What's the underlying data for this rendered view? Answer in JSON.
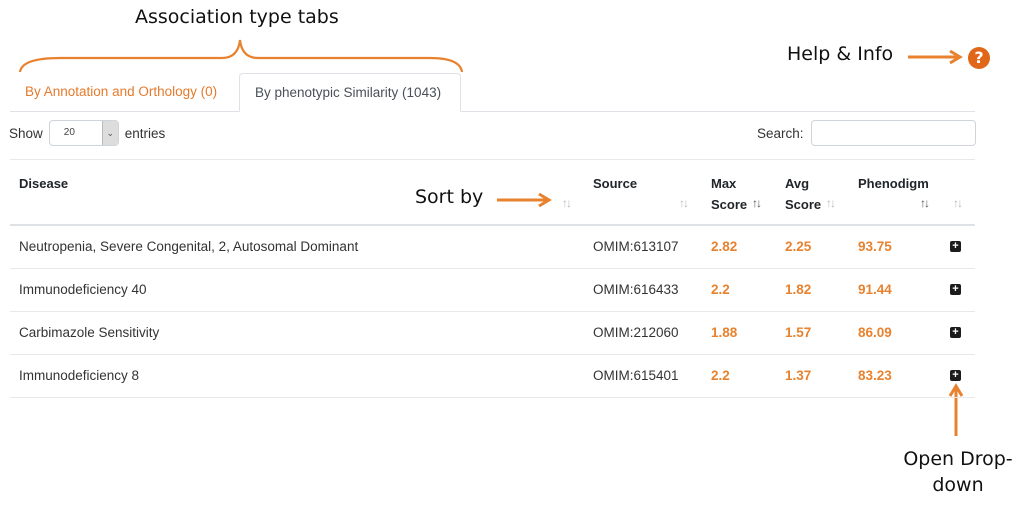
{
  "annotations": {
    "tabs": "Association type tabs",
    "help": "Help & Info",
    "sort": "Sort by",
    "dropdown_line1": "Open Drop-",
    "dropdown_line2": "down"
  },
  "colors": {
    "accent": "#e8822e",
    "help": "#e0661a"
  },
  "help_icon": {
    "glyph": "?",
    "icon": "question-circle-icon"
  },
  "tabs": [
    {
      "label": "By Annotation and Orthology (0)",
      "active": false
    },
    {
      "label": "By phenotypic Similarity (1043)",
      "active": true
    }
  ],
  "length_menu": {
    "prefix": "Show",
    "value": "20",
    "suffix": "entries",
    "arrow": "⌄"
  },
  "search": {
    "label": "Search:",
    "value": ""
  },
  "table": {
    "sort_glyph": "↑↓",
    "expand_glyph": "+",
    "headers": {
      "disease": "Disease",
      "source": "Source",
      "max_1": "Max",
      "max_2": "Score",
      "avg_1": "Avg",
      "avg_2": "Score",
      "phenodigm": "Phenodigm"
    },
    "rows": [
      {
        "disease": "Neutropenia, Severe Congenital, 2, Autosomal Dominant",
        "source": "OMIM:613107",
        "max": "2.82",
        "avg": "2.25",
        "phenodigm": "93.75"
      },
      {
        "disease": "Immunodeficiency 40",
        "source": "OMIM:616433",
        "max": "2.2",
        "avg": "1.82",
        "phenodigm": "91.44"
      },
      {
        "disease": "Carbimazole Sensitivity",
        "source": "OMIM:212060",
        "max": "1.88",
        "avg": "1.57",
        "phenodigm": "86.09"
      },
      {
        "disease": "Immunodeficiency 8",
        "source": "OMIM:615401",
        "max": "2.2",
        "avg": "1.37",
        "phenodigm": "83.23"
      }
    ]
  }
}
